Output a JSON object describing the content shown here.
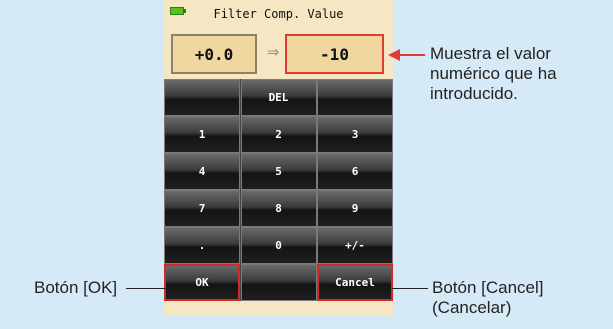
{
  "screen": {
    "title": "Filter Comp. Value",
    "current_value": "+0.0",
    "arrow_symbol": "⇒",
    "new_value": "-10"
  },
  "keypad": {
    "rows": [
      [
        "",
        "DEL",
        ""
      ],
      [
        "1",
        "2",
        "3"
      ],
      [
        "4",
        "5",
        "6"
      ],
      [
        "7",
        "8",
        "9"
      ],
      [
        ".",
        "0",
        "+/-"
      ],
      [
        "OK",
        "",
        "Cancel"
      ]
    ]
  },
  "annotations": {
    "value_note_line1": "Muestra el valor",
    "value_note_line2": "numérico que ha",
    "value_note_line3": "introducido.",
    "ok_note": "Botón [OK]",
    "cancel_note_line1": "Botón [Cancel]",
    "cancel_note_line2": "(Cancelar)"
  },
  "colors": {
    "highlight": "#e03a34",
    "screen_bg": "#f5e7c4",
    "page_bg": "#d6e9f7"
  }
}
